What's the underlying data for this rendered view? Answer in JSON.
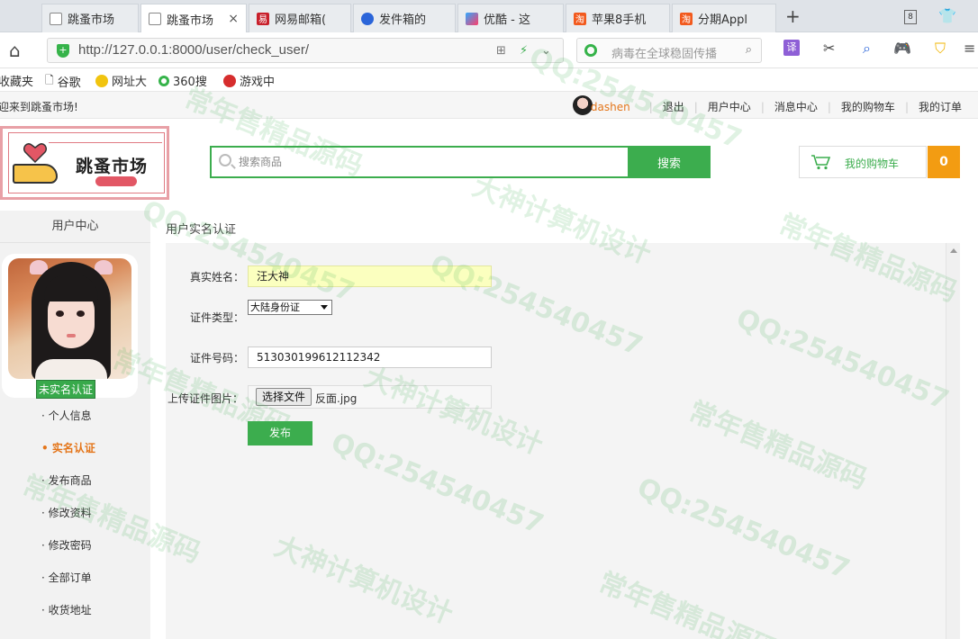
{
  "browser": {
    "tabs": [
      {
        "label": "跳蚤市场",
        "active": false,
        "favicon": "page-icon"
      },
      {
        "label": "跳蚤市场",
        "active": true,
        "favicon": "page-icon",
        "close": "×"
      },
      {
        "label": "网易邮箱(",
        "favicon": "netease-icon"
      },
      {
        "label": "发件箱的",
        "favicon": "baidu-paw-icon"
      },
      {
        "label": "优酷 - 这",
        "favicon": "youku-icon"
      },
      {
        "label": "苹果8手机",
        "favicon": "taobao-icon"
      },
      {
        "label": "分期Appl",
        "favicon": "taobao-icon"
      }
    ],
    "new_tab": "+",
    "tab_count": "8",
    "url": "http://127.0.0.1:8000/user/check_user/",
    "search_hint": "病毒在全球稳固传播",
    "translate_label": "译",
    "bookmarks": [
      "收藏夹",
      "谷歌",
      "网址大",
      "360搜",
      "游戏中"
    ]
  },
  "site_bar": {
    "welcome": "迎来到跳蚤市场!",
    "username": "dashen",
    "links": [
      "退出",
      "用户中心",
      "消息中心",
      "我的购物车",
      "我的订单"
    ]
  },
  "header": {
    "brand": "跳蚤市场",
    "search_placeholder": "搜索商品",
    "search_button": "搜索",
    "cart_label": "我的购物车",
    "cart_count": "0"
  },
  "sidebar": {
    "title": "用户中心",
    "status_badge": "未实名认证",
    "menu": [
      {
        "label": "· 个人信息",
        "active": false
      },
      {
        "label": "• 实名认证",
        "active": true
      },
      {
        "label": "· 发布商品",
        "active": false
      },
      {
        "label": "· 修改资料",
        "active": false
      },
      {
        "label": "· 修改密码",
        "active": false
      },
      {
        "label": "· 全部订单",
        "active": false
      },
      {
        "label": "· 收货地址",
        "active": false
      }
    ]
  },
  "main": {
    "breadcrumb": "用户实名认证",
    "form": {
      "name_label": "真实姓名：",
      "name_value": "汪大神",
      "id_type_label": "证件类型：",
      "id_type_value": "大陆身份证",
      "id_number_label": "证件号码：",
      "id_number_value": "513030199612112342",
      "upload_label": "上传证件图片：",
      "upload_button": "选择文件",
      "upload_file": "反面.jpg",
      "submit": "发布"
    }
  },
  "watermarks": [
    "常年售精品源码",
    "QQ:254540457",
    "大神计算机设计"
  ],
  "colors": {
    "accent": "#3cad4e",
    "orange": "#f39c12",
    "active_menu": "#e4761b"
  }
}
